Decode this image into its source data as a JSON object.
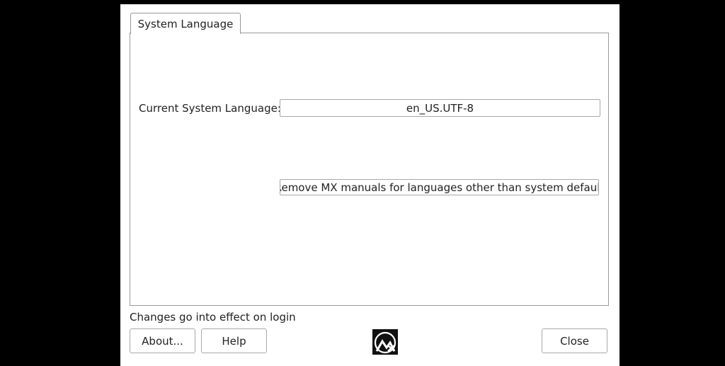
{
  "tabs": [
    {
      "label": "System Language"
    }
  ],
  "system_language": {
    "label": "Current System Language:",
    "value": "en_US.UTF-8"
  },
  "remove_manuals_button": "Remove MX manuals for languages other than system default",
  "status_note": "Changes go into effect on login",
  "buttons": {
    "about": "About...",
    "help": "Help",
    "close": "Close"
  },
  "icons": {
    "logo": "mx-linux-logo-icon"
  }
}
